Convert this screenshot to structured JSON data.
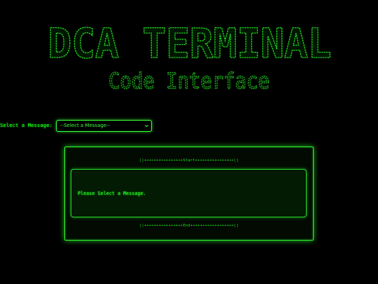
{
  "banner": {
    "title": "DCA TERMINAL",
    "subtitle": "Code Interface"
  },
  "select": {
    "label": "Select a Message:",
    "value": "--Select a Message--",
    "chevron_icon": "chevron-down-icon"
  },
  "output": {
    "start_marker": "||++++++++++++++++Start++++++++++++++++||",
    "message": "Please Select a Message.",
    "end_marker": "||++++++++++++++++End++++++++++++++++++||"
  },
  "colors": {
    "background": "#000000",
    "terminal_green": "#33ff33",
    "panel_fill": "#031a03"
  }
}
